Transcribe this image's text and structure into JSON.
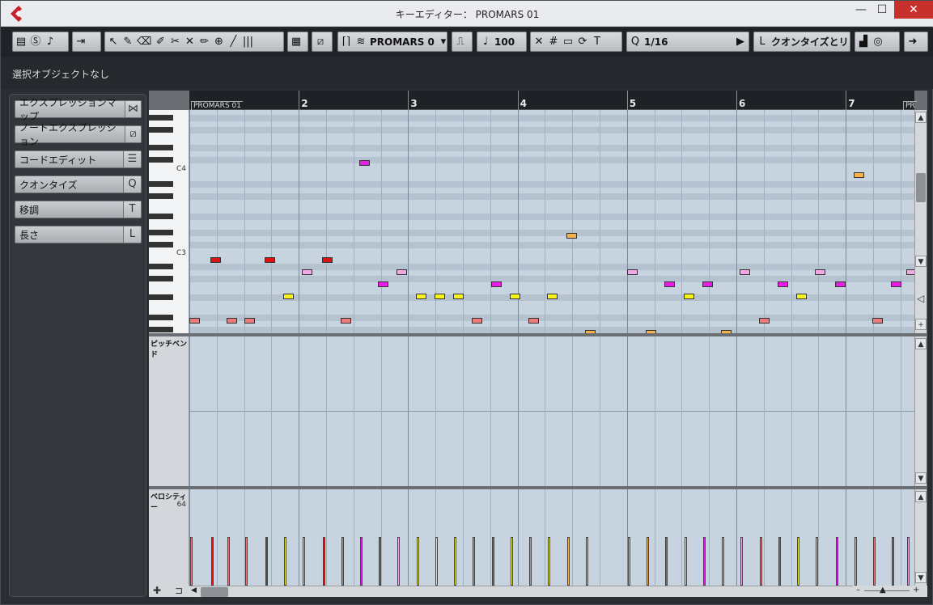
{
  "window": {
    "title": "キーエディター： PROMARS 01",
    "min": "—",
    "max": "☐",
    "close": "✕",
    "icon": "cubase-logo-icon"
  },
  "toolbar": {
    "part_name": "PROMARS 0",
    "velocity": "100",
    "quantize": "1/16",
    "quantize_link": "クオンタイズとリン",
    "q_label": "Q",
    "l_label": "L"
  },
  "info": {
    "status": "選択オブジェクトなし"
  },
  "inspector": {
    "items": [
      {
        "label": "エクスプレッションマップ",
        "symbol": "⋈"
      },
      {
        "label": "ノートエクスプレッション",
        "symbol": "⧄"
      },
      {
        "label": "コードエディット",
        "symbol": "☰"
      },
      {
        "label": "クオンタイズ",
        "symbol": "Q"
      },
      {
        "label": "移調",
        "symbol": "T"
      },
      {
        "label": "長さ",
        "symbol": "L"
      }
    ]
  },
  "ruler": {
    "part_label": "PROMARS 01",
    "part_label_2": "PR",
    "bars": [
      "2",
      "3",
      "4",
      "5",
      "6",
      "7"
    ]
  },
  "keyboard": {
    "c4": "C4",
    "c3": "C3"
  },
  "lanes": {
    "pitchbend": "ピッチベンド",
    "velocity": "ベロシティー",
    "velocity_value": "64"
  },
  "colors": {
    "red": "#e01010",
    "salmon": "#ef7a7a",
    "pink": "#f5a6e6",
    "magenta": "#e81ee8",
    "yellow": "#f6f21a",
    "orange": "#f5b24a",
    "grid_bg": "#c7d4e0"
  },
  "notes": [
    {
      "bar": 1.0,
      "row": 18,
      "color": "salmon"
    },
    {
      "bar": 1.19,
      "row": 13,
      "color": "red"
    },
    {
      "bar": 1.34,
      "row": 18,
      "color": "salmon"
    },
    {
      "bar": 1.5,
      "row": 18,
      "color": "salmon"
    },
    {
      "bar": 1.69,
      "row": 13,
      "color": "red"
    },
    {
      "bar": 1.86,
      "row": 16,
      "color": "yellow"
    },
    {
      "bar": 2.03,
      "row": 14,
      "color": "pink"
    },
    {
      "bar": 2.21,
      "row": 13,
      "color": "red"
    },
    {
      "bar": 2.38,
      "row": 18,
      "color": "salmon"
    },
    {
      "bar": 2.55,
      "row": 5,
      "color": "magenta"
    },
    {
      "bar": 2.72,
      "row": 15,
      "color": "magenta"
    },
    {
      "bar": 2.89,
      "row": 14,
      "color": "pink"
    },
    {
      "bar": 3.07,
      "row": 16,
      "color": "yellow"
    },
    {
      "bar": 3.24,
      "row": 16,
      "color": "yellow"
    },
    {
      "bar": 3.41,
      "row": 16,
      "color": "yellow"
    },
    {
      "bar": 3.58,
      "row": 18,
      "color": "salmon"
    },
    {
      "bar": 3.76,
      "row": 15,
      "color": "magenta"
    },
    {
      "bar": 3.93,
      "row": 16,
      "color": "yellow"
    },
    {
      "bar": 4.1,
      "row": 18,
      "color": "salmon"
    },
    {
      "bar": 4.27,
      "row": 16,
      "color": "yellow"
    },
    {
      "bar": 4.45,
      "row": 11,
      "color": "orange"
    },
    {
      "bar": 4.62,
      "row": 19,
      "color": "orange"
    },
    {
      "bar": 5.0,
      "row": 14,
      "color": "pink"
    },
    {
      "bar": 5.17,
      "row": 19,
      "color": "orange"
    },
    {
      "bar": 5.34,
      "row": 15,
      "color": "magenta"
    },
    {
      "bar": 5.52,
      "row": 16,
      "color": "yellow"
    },
    {
      "bar": 5.69,
      "row": 15,
      "color": "magenta"
    },
    {
      "bar": 5.86,
      "row": 19,
      "color": "orange"
    },
    {
      "bar": 6.03,
      "row": 14,
      "color": "pink"
    },
    {
      "bar": 6.21,
      "row": 18,
      "color": "salmon"
    },
    {
      "bar": 6.38,
      "row": 15,
      "color": "magenta"
    },
    {
      "bar": 6.55,
      "row": 16,
      "color": "yellow"
    },
    {
      "bar": 6.72,
      "row": 14,
      "color": "pink"
    },
    {
      "bar": 6.9,
      "row": 15,
      "color": "magenta"
    },
    {
      "bar": 7.07,
      "row": 6,
      "color": "orange"
    },
    {
      "bar": 7.24,
      "row": 18,
      "color": "salmon"
    },
    {
      "bar": 7.41,
      "row": 15,
      "color": "magenta"
    },
    {
      "bar": 7.55,
      "row": 14,
      "color": "pink"
    }
  ]
}
